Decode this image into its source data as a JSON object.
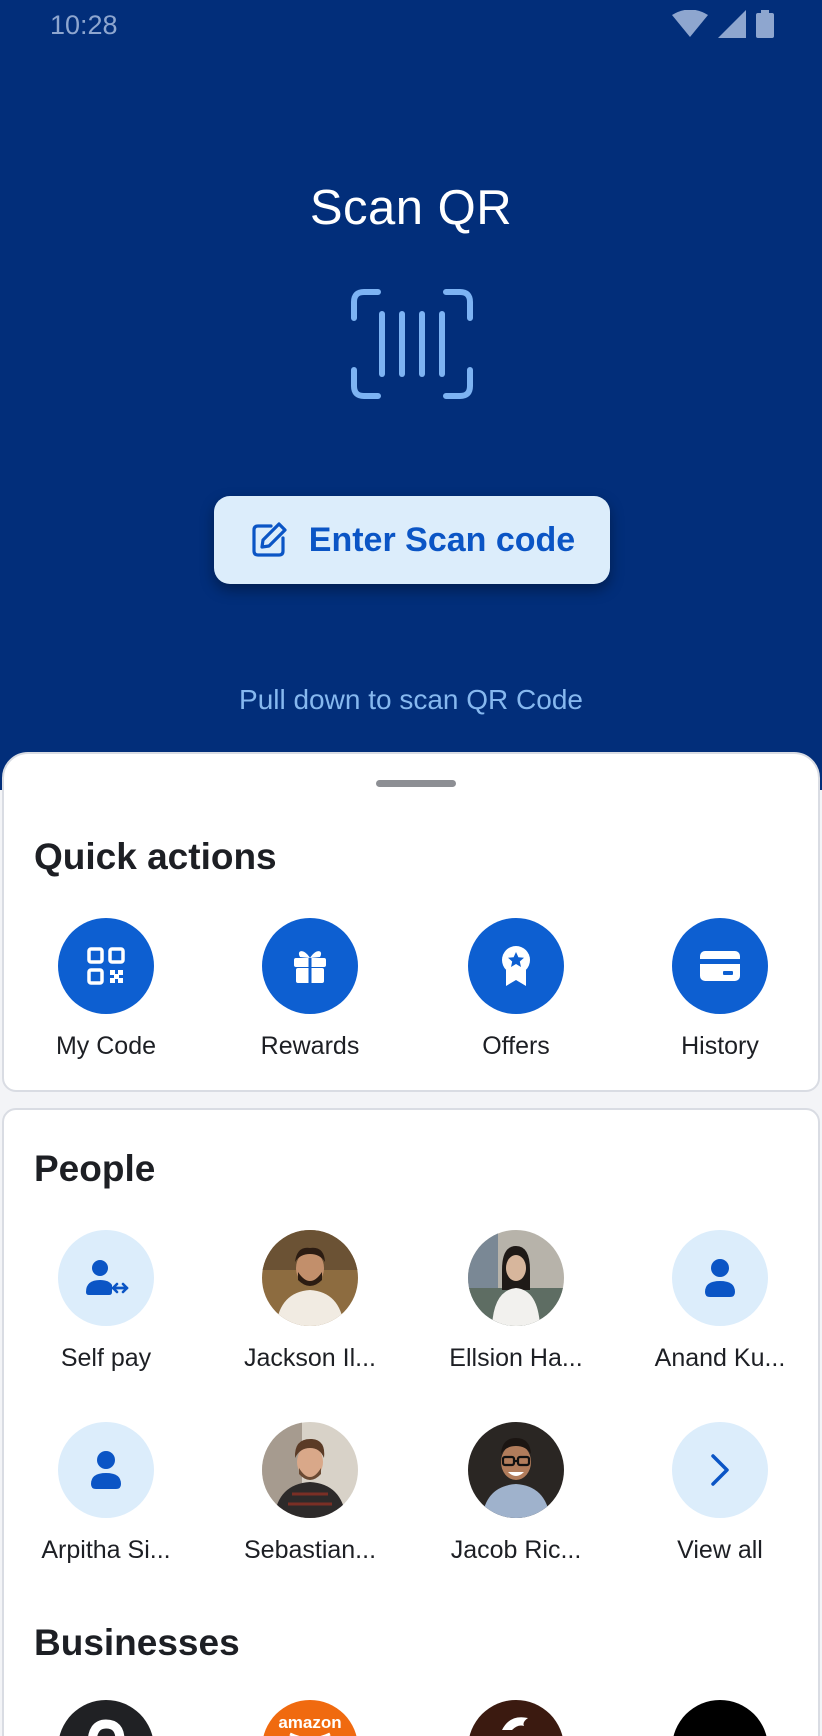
{
  "status_bar": {
    "time": "10:28"
  },
  "header": {
    "title": "Scan QR",
    "enter_button_label": "Enter Scan code",
    "pull_hint": "Pull down to scan QR Code"
  },
  "quick_actions": {
    "title": "Quick actions",
    "items": [
      {
        "label": "My Code",
        "icon": "qr-code-icon"
      },
      {
        "label": "Rewards",
        "icon": "gift-icon"
      },
      {
        "label": "Offers",
        "icon": "badge-star-icon"
      },
      {
        "label": "History",
        "icon": "card-icon"
      }
    ]
  },
  "people": {
    "title": "People",
    "items": [
      {
        "label": "Self pay",
        "icon": "self-pay-icon"
      },
      {
        "label": "Jackson Il...",
        "icon": "avatar-photo"
      },
      {
        "label": "Ellsion Ha...",
        "icon": "avatar-photo"
      },
      {
        "label": "Anand Ku...",
        "icon": "person-icon"
      },
      {
        "label": "Arpitha Si...",
        "icon": "person-icon"
      },
      {
        "label": "Sebastian...",
        "icon": "avatar-photo"
      },
      {
        "label": "Jacob Ric...",
        "icon": "avatar-photo"
      },
      {
        "label": "View all",
        "icon": "chevron-right-icon"
      }
    ]
  },
  "businesses": {
    "title": "Businesses",
    "logos": [
      "question-mark-logo",
      "amazon-logo",
      "horse-logo",
      "black-logo"
    ],
    "amazon_text": "amazon"
  },
  "colors": {
    "header_bg": "#022e7a",
    "accent": "#0d5fd1",
    "light_accent": "#dcedfb",
    "hint_text": "#86b8ef"
  }
}
